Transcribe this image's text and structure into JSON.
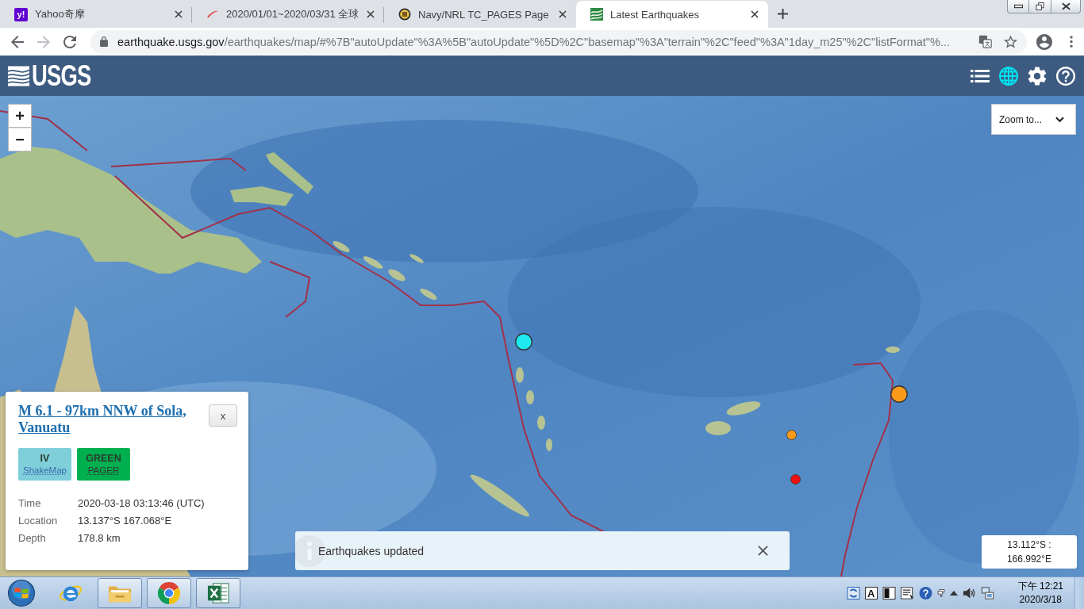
{
  "browser": {
    "tabs": [
      {
        "kind": "letters",
        "icon_text": "y!",
        "title": "Yahoo奇摩",
        "selected": false
      },
      {
        "kind": "swoosh",
        "title": "2020/01/01~2020/03/31 全球",
        "selected": false
      },
      {
        "kind": "emblem",
        "title": "Navy/NRL TC_PAGES Page",
        "selected": false
      },
      {
        "kind": "waves",
        "title": "Latest Earthquakes",
        "selected": true
      }
    ],
    "nav_buttons": [
      {
        "kind": "back",
        "disabled": false
      },
      {
        "kind": "forward",
        "disabled": true
      },
      {
        "kind": "reload",
        "disabled": false
      }
    ],
    "address": {
      "host": "earthquake.usgs.gov",
      "path": "/earthquakes/map/#%7B\"autoUpdate\"%3A%5B\"autoUpdate\"%5D%2C\"basemap\"%3A\"terrain\"%2C\"feed\"%3A\"1day_m25\"%2C\"listFormat\"%..."
    }
  },
  "header": {
    "logo": "USGS",
    "view_buttons": [
      {
        "kind": "list",
        "selected": false
      },
      {
        "kind": "map",
        "selected": true
      }
    ]
  },
  "map": {
    "zoom_buttons": [
      "+",
      "−"
    ],
    "zoom_to": "Zoom to...",
    "markers": [
      {
        "kind": "large",
        "color": "#1ee9f0"
      },
      {
        "kind": "large",
        "color": "#fb9a1b"
      },
      {
        "kind": "small",
        "color": "#fb9a1b"
      },
      {
        "kind": "small",
        "color": "#ee1111"
      }
    ],
    "popup": {
      "title": "M 6.1 - 97km NNW of Sola, Vanuatu",
      "close": "x",
      "badges": [
        {
          "value": "IV",
          "label": "ShakeMap",
          "color": "#7fcfdb"
        },
        {
          "value": "GREEN",
          "label": "PAGER",
          "color": "#00b050"
        }
      ],
      "details": [
        {
          "label": "Time",
          "value": "2020-03-18 03:13:46 (UTC)"
        },
        {
          "label": "Location",
          "value": "13.137°S 167.068°E"
        },
        {
          "label": "Depth",
          "value": "178.8 km"
        }
      ]
    },
    "notification": "Earthquakes updated",
    "coordinates": "13.112°S : 166.992°E"
  },
  "taskbar": {
    "apps": [
      {
        "kind": "ie",
        "running": false
      },
      {
        "kind": "folder",
        "running": true
      },
      {
        "kind": "chrome",
        "running": true
      },
      {
        "kind": "excel",
        "running": true
      }
    ],
    "ime_mode": "A",
    "clock": {
      "time": "下午 12:21",
      "date": "2020/3/18"
    }
  }
}
